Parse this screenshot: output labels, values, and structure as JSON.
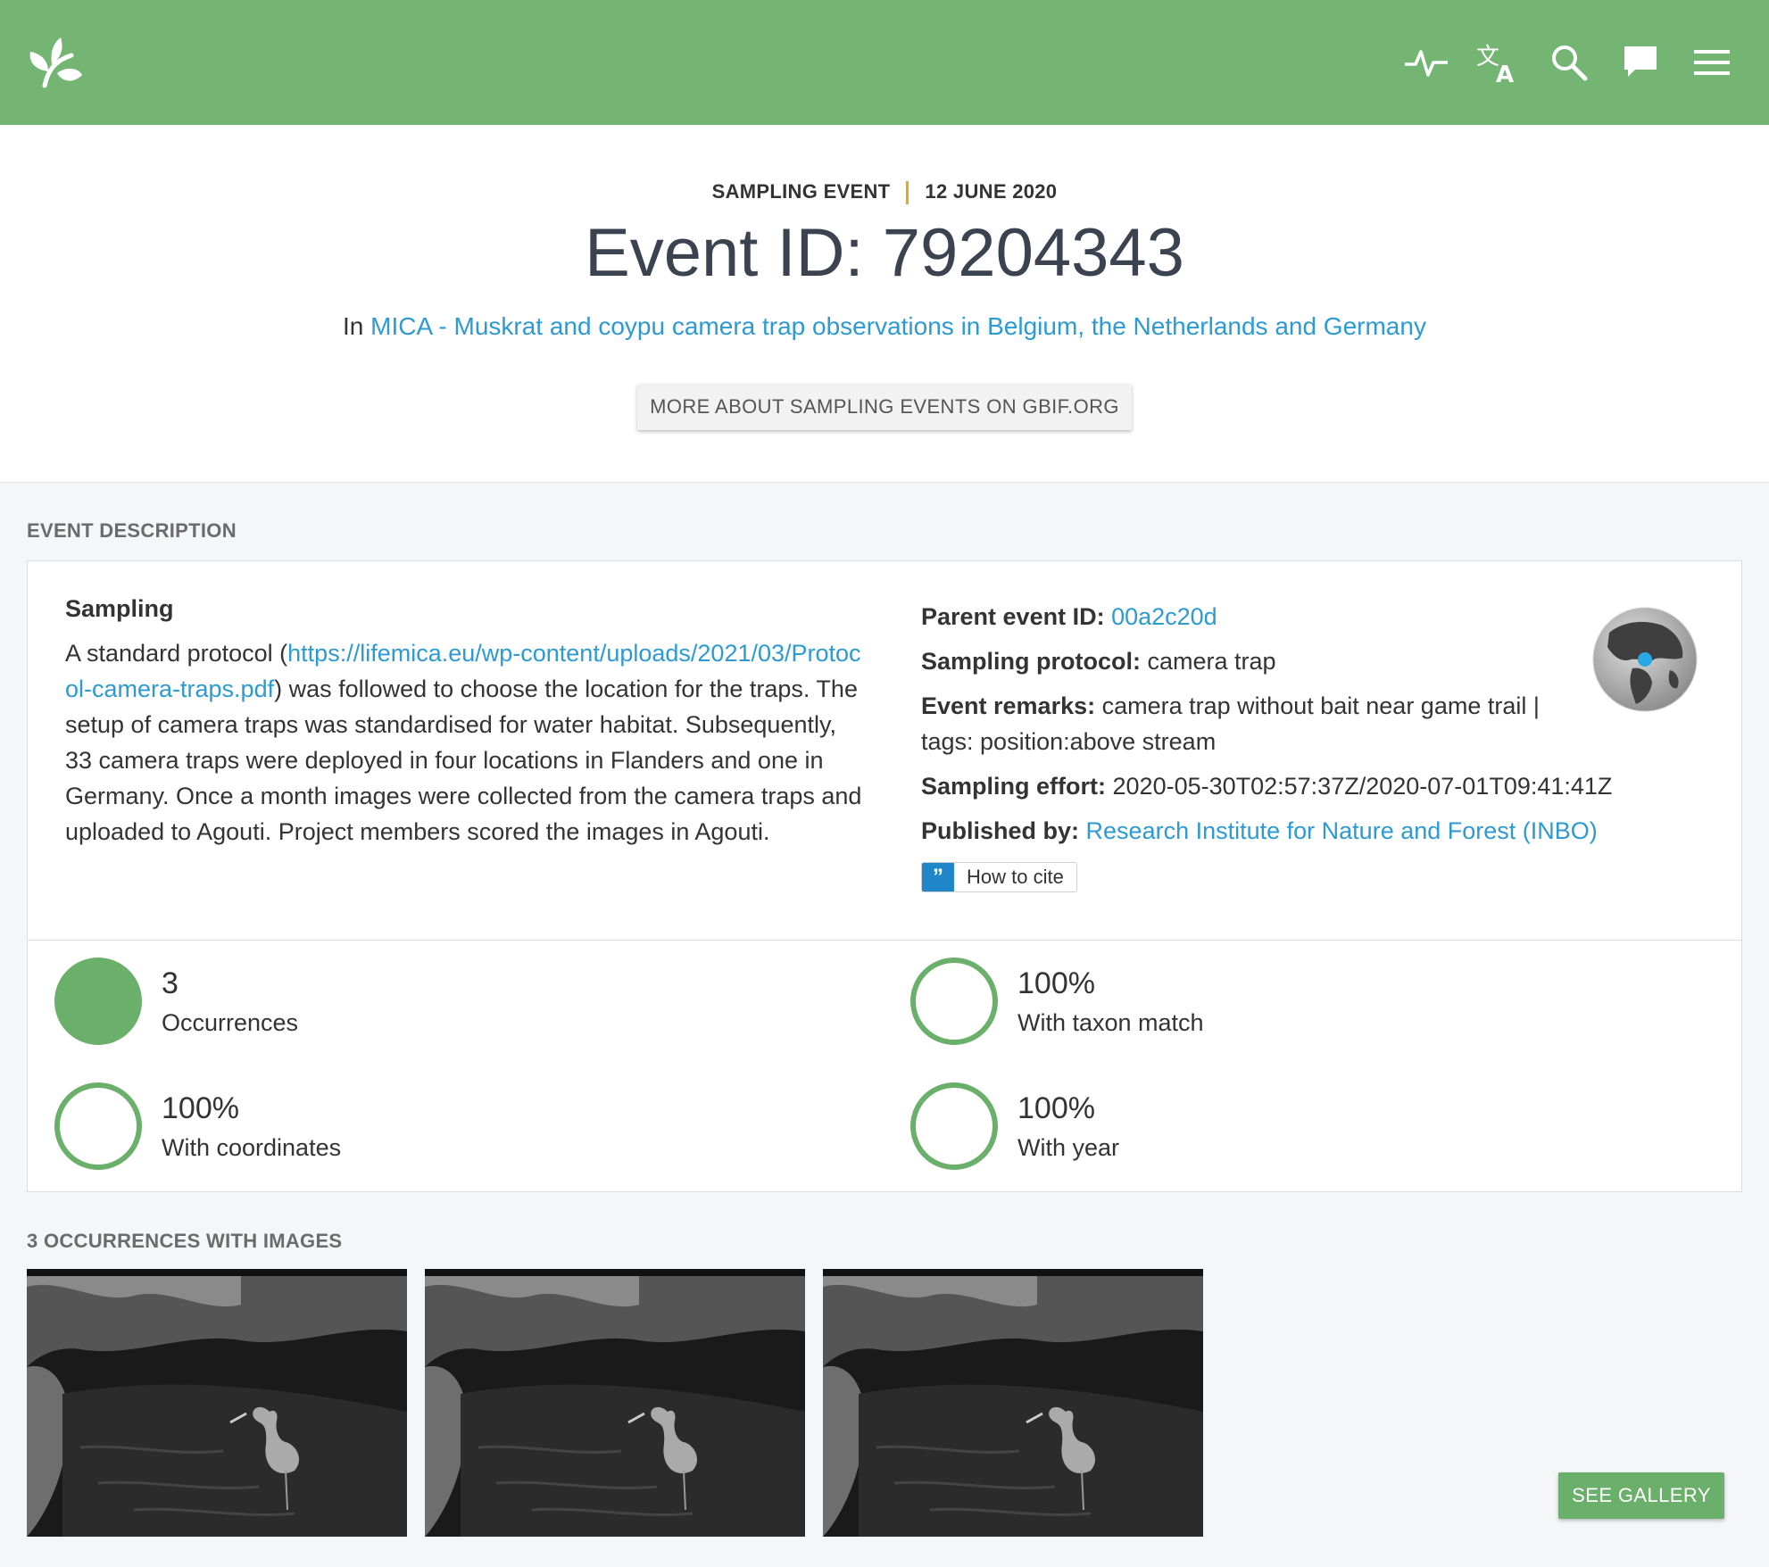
{
  "topbar": {
    "logo_icon": "gbif-leaf-logo-icon",
    "icons": [
      "activity-icon",
      "translate-icon",
      "search-icon",
      "feedback-icon",
      "menu-icon"
    ]
  },
  "header": {
    "kicker_type": "SAMPLING EVENT",
    "kicker_date": "12 JUNE 2020",
    "title": "Event ID: 79204343",
    "dataset_prefix": "In ",
    "dataset_link": "MICA - Muskrat and coypu camera trap observations in Belgium, the Netherlands and Germany",
    "more_button": "MORE ABOUT SAMPLING EVENTS ON GBIF.ORG"
  },
  "event_description": {
    "section_title": "EVENT DESCRIPTION",
    "sampling_heading": "Sampling",
    "desc_prefix": "A standard protocol (",
    "desc_link": "https://lifemica.eu/wp-content/uploads/2021/03/Protocol-camera-traps.pdf",
    "desc_suffix": ") was followed to choose the location for the traps. The setup of camera traps was standardised for water habitat. Subsequently, 33 camera traps were deployed in four locations in Flanders and one in Germany. Once a month images were collected from the camera traps and uploaded to Agouti. Project members scored the images in Agouti.",
    "parent_event_label": "Parent event ID:",
    "parent_event_value": "00a2c20d",
    "protocol_label": "Sampling protocol:",
    "protocol_value": "camera trap",
    "remarks_label": "Event remarks:",
    "remarks_value": "camera trap without bait near game trail | tags: position:above stream",
    "effort_label": "Sampling effort:",
    "effort_value": "2020-05-30T02:57:37Z/2020-07-01T09:41:41Z",
    "published_label": "Published by:",
    "published_value": "Research Institute for Nature and Forest (INBO)",
    "cite_button": "How to cite"
  },
  "stats": [
    {
      "value": "3",
      "label": "Occurrences",
      "fraction": 1.0
    },
    {
      "value": "100%",
      "label": "With taxon match",
      "fraction": 1.0
    },
    {
      "value": "100%",
      "label": "With coordinates",
      "fraction": 1.0
    },
    {
      "value": "100%",
      "label": "With year",
      "fraction": 1.0
    }
  ],
  "images_section": {
    "title": "3 OCCURRENCES WITH IMAGES",
    "see_gallery": "SEE GALLERY",
    "image_count": 3
  },
  "colors": {
    "brand_green": "#74b574",
    "link_blue": "#2d9ad1",
    "accent_orange": "#e6a817"
  }
}
